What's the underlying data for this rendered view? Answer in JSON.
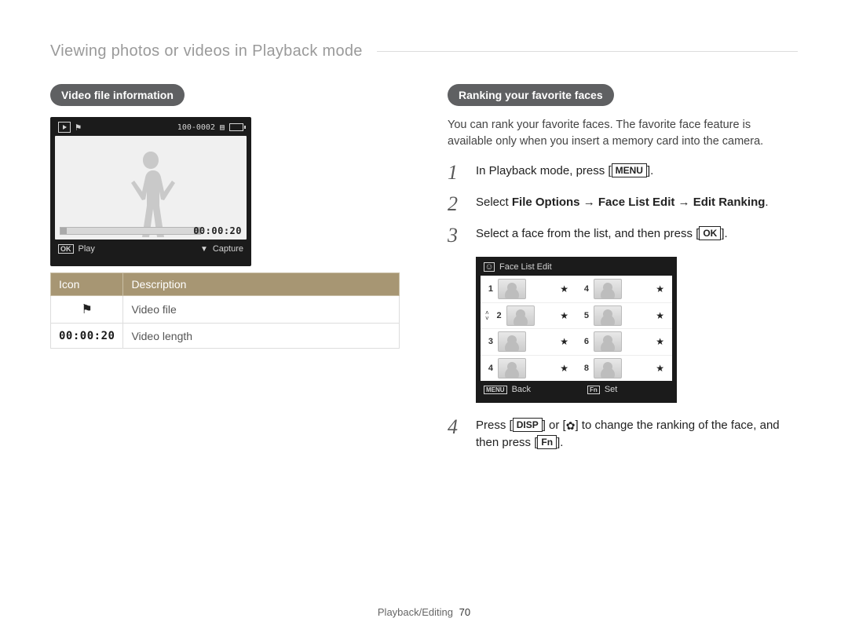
{
  "header": {
    "title": "Viewing photos or videos in Playback mode"
  },
  "left": {
    "heading": "Video file information",
    "preview": {
      "counter": "100-0002",
      "elapsed": "00:00:20",
      "footer_play_label": "Play",
      "footer_capture_label": "Capture",
      "footer_ok": "OK",
      "footer_down": "▼"
    },
    "table": {
      "head_icon": "Icon",
      "head_desc": "Description",
      "rows": [
        {
          "icon_name": "video-file-icon",
          "desc": "Video file"
        },
        {
          "icon_text": "00:00:20",
          "desc": "Video length"
        }
      ]
    }
  },
  "right": {
    "heading": "Ranking your favorite faces",
    "intro": "You can rank your favorite faces. The favorite face feature is available only when you insert a memory card into the camera.",
    "steps": {
      "s1_a": "In Playback mode, press [",
      "s1_btn": "MENU",
      "s1_b": "].",
      "s2_a": "Select ",
      "s2_b": "File Options → Face List Edit → Edit Ranking",
      "s2_c": ".",
      "s3_a": "Select a face from the list, and then press [",
      "s3_btn": "OK",
      "s3_b": "].",
      "s4_a": "Press [",
      "s4_btn1": "DISP",
      "s4_b": "] or [",
      "s4_flower": "✿",
      "s4_c": "] to change the ranking of the face, and then press [",
      "s4_btn2": "Fn",
      "s4_d": "]."
    },
    "faceedit": {
      "title": "Face List Edit",
      "back_tag": "MENU",
      "back_label": "Back",
      "set_tag": "Fn",
      "set_label": "Set",
      "left_nums": [
        "1",
        "2",
        "3",
        "4"
      ],
      "right_nums": [
        "4",
        "5",
        "6",
        "8"
      ]
    }
  },
  "footer": {
    "section": "Playback/Editing",
    "page": "70"
  }
}
